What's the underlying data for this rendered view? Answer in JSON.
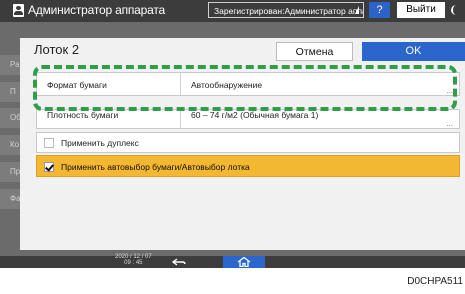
{
  "topbar": {
    "title": "Администратор аппарата",
    "logged_in": "Зарегистрирован:Администратор аппарат",
    "help_label": "?",
    "logout_label": "Выйти"
  },
  "background": {
    "tabs": [
      "Ра",
      "П",
      "Об",
      "Ко",
      "Пр",
      "Фа"
    ]
  },
  "dialog": {
    "title": "Лоток 2",
    "cancel_label": "Отмена",
    "ok_label": "OK",
    "paper_format": {
      "label": "Формат бумаги",
      "value": "Автообнаружение"
    },
    "paper_weight": {
      "label": "Плотность бумаги",
      "value": "60 – 74 г/м2 (Обычная бумага 1)"
    },
    "duplex": {
      "label": "Применить дуплекс",
      "checked": false
    },
    "auto_select": {
      "label": "Применить автовыбор бумаги/Автовыбор лотка",
      "checked": true
    }
  },
  "bottombar": {
    "date": "2020 / 12 / 07",
    "time": "09 : 45"
  },
  "figure_code": "D0CHPA511",
  "colors": {
    "accent_blue": "#2b66cc",
    "highlight_yellow": "#f3b731",
    "highlight_green": "#2f9e4b"
  }
}
